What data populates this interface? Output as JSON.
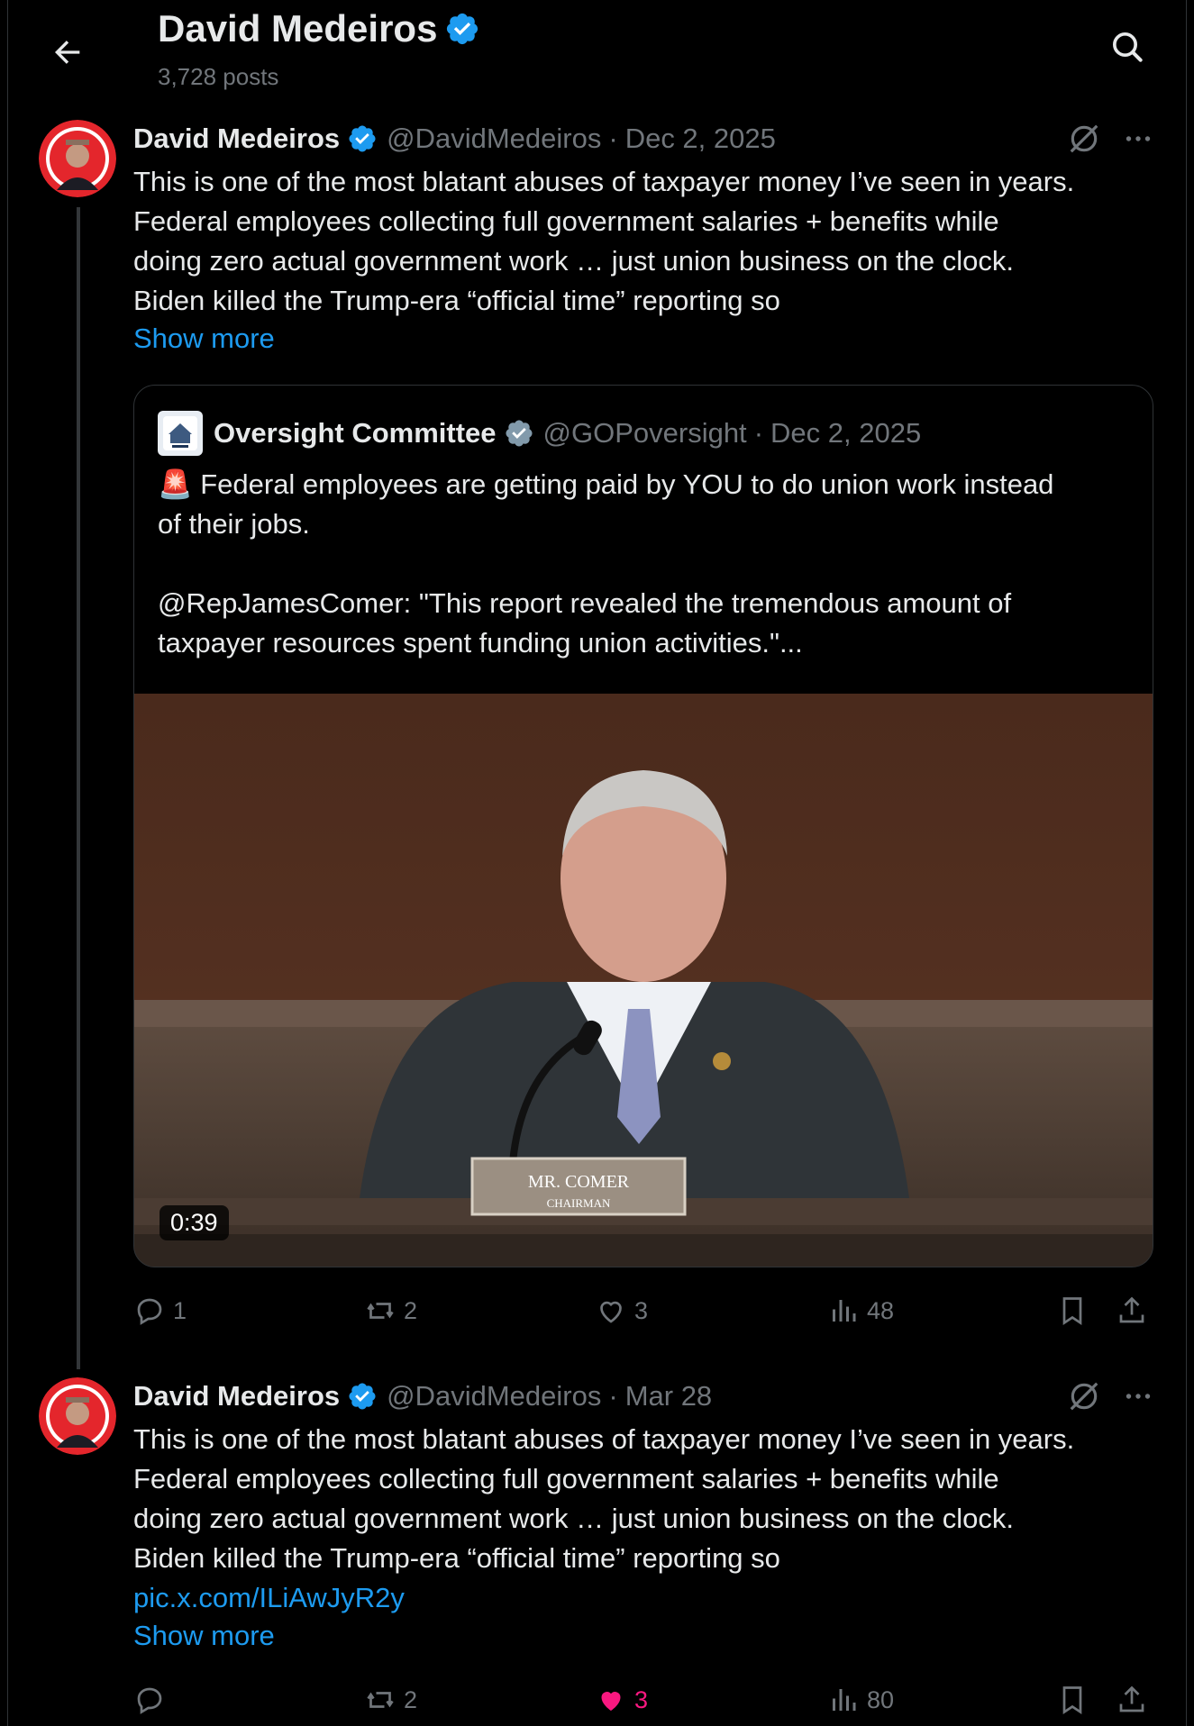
{
  "header": {
    "title": "David Medeiros",
    "posts_count": "3,728 posts"
  },
  "colors": {
    "background": "#000000",
    "text": "#e7e9ea",
    "muted": "#71767b",
    "link": "#1d9bf0",
    "like_active": "#f91880",
    "verified": "#1d9bf0"
  },
  "posts": [
    {
      "author": "David Medeiros",
      "handle": "@DavidMedeiros",
      "separator": "·",
      "date": "Dec 2, 2025",
      "text_lines": [
        "This is one of the most blatant abuses of taxpayer money I’ve seen in years.",
        "Federal employees collecting full government salaries + benefits while",
        "doing zero actual government work … just union business on the clock.",
        "Biden killed the Trump-era “official time” reporting so"
      ],
      "show_more": "Show more",
      "quote": {
        "author": "Oversight Committee",
        "handle": "@GOPoversight",
        "separator": "·",
        "date": "Dec 2, 2025",
        "line1": "🚨 Federal employees are getting paid by YOU to do union work instead",
        "line2": "of their jobs.",
        "line3": "@RepJamesComer: \"This report revealed the tremendous amount of",
        "line4": "taxpayer resources spent funding union activities.\"...",
        "video_duration": "0:39",
        "nameplate_name": "MR. COMER",
        "nameplate_title": "CHAIRMAN"
      },
      "stats": {
        "replies": "1",
        "reposts": "2",
        "likes": "3",
        "views": "48"
      }
    },
    {
      "author": "David Medeiros",
      "handle": "@DavidMedeiros",
      "separator": "·",
      "date": "Mar 28",
      "text_lines": [
        "This is one of the most blatant abuses of taxpayer money I’ve seen in years.",
        "Federal employees collecting full government salaries + benefits while",
        "doing zero actual government work … just union business on the clock.",
        "Biden killed the Trump-era “official time” reporting so"
      ],
      "link": "pic.x.com/ILiAwJyR2y",
      "show_more": "Show more",
      "stats": {
        "replies": "",
        "reposts": "2",
        "likes": "3",
        "views": "80"
      },
      "liked": true
    }
  ]
}
